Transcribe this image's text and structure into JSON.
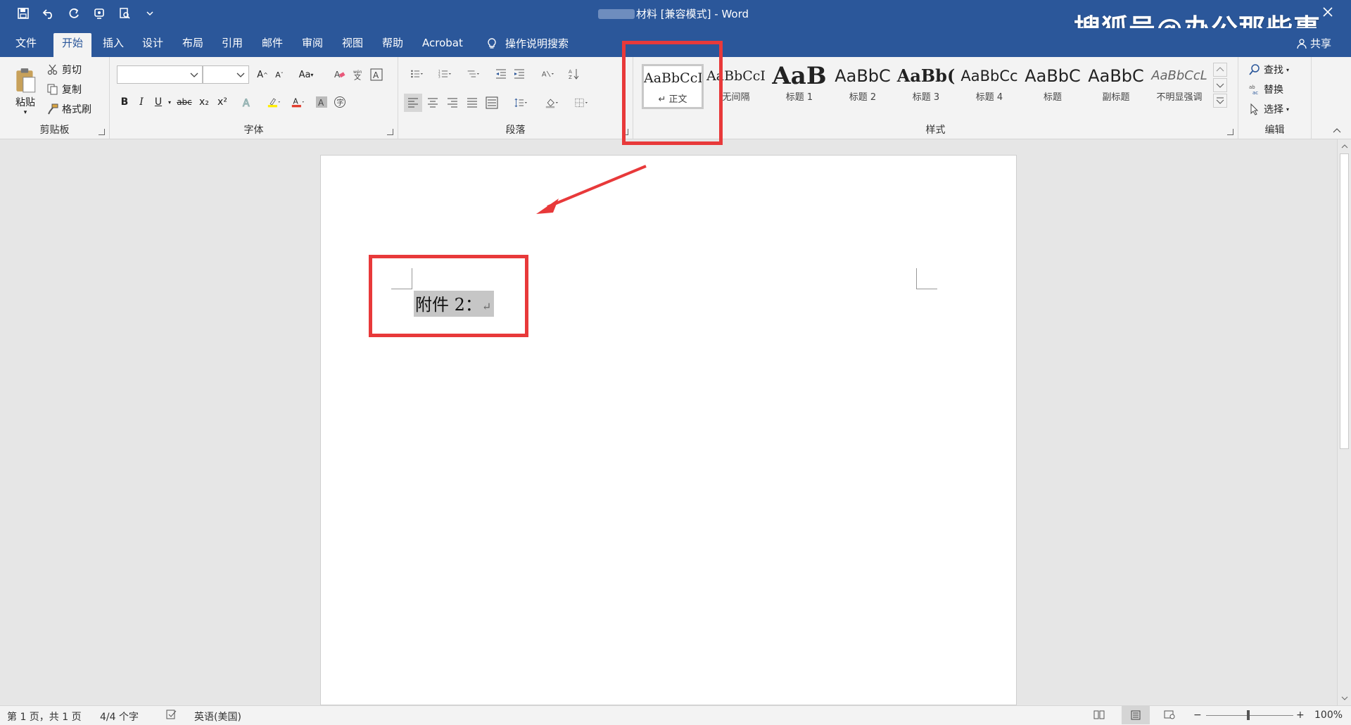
{
  "title_bar": {
    "doc_name_suffix": "材料 [兼容模式]",
    "separator": " - ",
    "app_name": "Word",
    "watermark": "搜狐号@办公那些事"
  },
  "tabs": [
    {
      "label": "文件"
    },
    {
      "label": "开始"
    },
    {
      "label": "插入"
    },
    {
      "label": "设计"
    },
    {
      "label": "布局"
    },
    {
      "label": "引用"
    },
    {
      "label": "邮件"
    },
    {
      "label": "审阅"
    },
    {
      "label": "视图"
    },
    {
      "label": "帮助"
    },
    {
      "label": "Acrobat"
    }
  ],
  "tell_me": "操作说明搜索",
  "share": "共享",
  "clipboard": {
    "label": "剪贴板",
    "paste": "粘贴",
    "cut": "剪切",
    "copy": "复制",
    "format_painter": "格式刷"
  },
  "font": {
    "label": "字体",
    "font_name": "",
    "font_size": "",
    "change_case": "Aa",
    "bold": "B",
    "italic": "I",
    "underline": "U",
    "strike": "abc",
    "subscript": "x₂",
    "superscript": "x²",
    "font_color": "A"
  },
  "paragraph": {
    "label": "段落"
  },
  "styles": {
    "label": "样式",
    "items": [
      {
        "preview": "AaBbCcI",
        "name": "↵ 正文"
      },
      {
        "preview": "AaBbCcI",
        "name": "无间隔"
      },
      {
        "preview": "AaB",
        "name": "标题 1"
      },
      {
        "preview": "AaBbC",
        "name": "标题 2"
      },
      {
        "preview": "AaBb(",
        "name": "标题 3"
      },
      {
        "preview": "AaBbCc",
        "name": "标题 4"
      },
      {
        "preview": "AaBbC",
        "name": "标题"
      },
      {
        "preview": "AaBbC",
        "name": "副标题"
      },
      {
        "preview": "AaBbCcL",
        "name": "不明显强调"
      }
    ]
  },
  "editing": {
    "label": "编辑",
    "find": "查找",
    "replace": "替换",
    "select": "选择"
  },
  "document": {
    "text": "附件 2：",
    "paragraph_mark": "↵"
  },
  "status": {
    "page": "第 1 页，共 1 页",
    "words": "4/4 个字",
    "language": "英语(美国)",
    "zoom": "100%"
  },
  "colors": {
    "accent": "#2b579a",
    "annotation": "#e8393a"
  }
}
